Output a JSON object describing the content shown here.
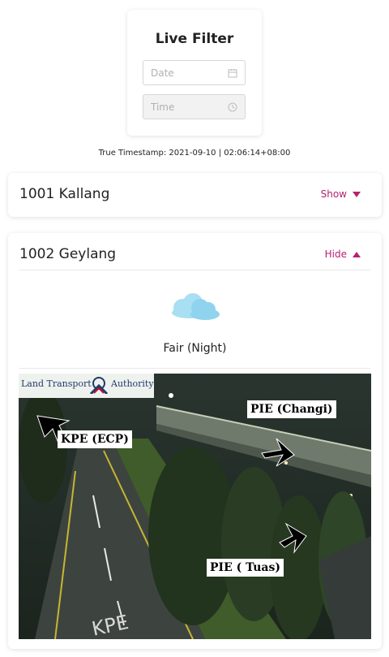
{
  "filter": {
    "title": "Live Filter",
    "date_placeholder": "Date",
    "time_placeholder": "Time"
  },
  "timestamp_text": "True Timestamp: 2021-09-10 | 02:06:14+08:00",
  "regions": [
    {
      "name": "1001 Kallang",
      "toggle_label": "Show",
      "expanded": false
    },
    {
      "name": "1002 Geylang",
      "toggle_label": "Hide",
      "expanded": true,
      "weather": "Fair (Night)",
      "weather_icon": "cloud-icon",
      "camera": {
        "logo_left": "Land Transport",
        "logo_right": "Authority",
        "labels": [
          "KPE (ECP)",
          "PIE (Changi)",
          "PIE ( Tuas)"
        ],
        "road_marking": "KPE"
      }
    }
  ],
  "colors": {
    "accent": "#b5226f",
    "cloud": "#8fd3ef"
  }
}
